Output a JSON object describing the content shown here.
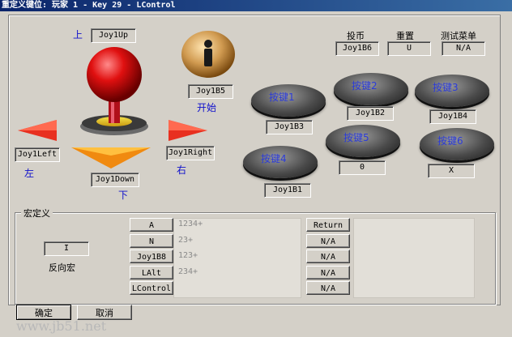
{
  "window": {
    "title": "重定义键位: 玩家 1 - Key 29 - LControl"
  },
  "directions": {
    "up": {
      "label": "上",
      "value": "Joy1Up"
    },
    "down": {
      "label": "下",
      "value": "Joy1Down"
    },
    "left": {
      "label": "左",
      "value": "Joy1Left"
    },
    "right": {
      "label": "右",
      "value": "Joy1Right"
    }
  },
  "start": {
    "label": "开始",
    "value": "Joy1B5"
  },
  "system": [
    {
      "label": "投币",
      "value": "Joy1B6"
    },
    {
      "label": "重置",
      "value": "U"
    },
    {
      "label": "测试菜单",
      "value": "N/A"
    }
  ],
  "buttons": [
    {
      "label": "按键1",
      "value": "Joy1B3"
    },
    {
      "label": "按键2",
      "value": "Joy1B2"
    },
    {
      "label": "按键3",
      "value": "Joy1B4"
    },
    {
      "label": "按键4",
      "value": "Joy1B1"
    },
    {
      "label": "按键5",
      "value": "0"
    },
    {
      "label": "按键6",
      "value": "X"
    }
  ],
  "macro": {
    "title": "宏定义",
    "reverse_value": "I",
    "reverse_label": "反向宏",
    "keys": [
      {
        "key": "A",
        "seq": "1234+"
      },
      {
        "key": "N",
        "seq": "23+"
      },
      {
        "key": "Joy1B8",
        "seq": "123+"
      },
      {
        "key": "LAlt",
        "seq": "234+"
      },
      {
        "key": "LControl",
        "seq": ""
      }
    ],
    "right_keys": [
      "Return",
      "N/A",
      "N/A",
      "N/A",
      "N/A"
    ]
  },
  "footer": {
    "ok": "确定",
    "cancel": "取消"
  },
  "watermark": "www.jb51.net"
}
